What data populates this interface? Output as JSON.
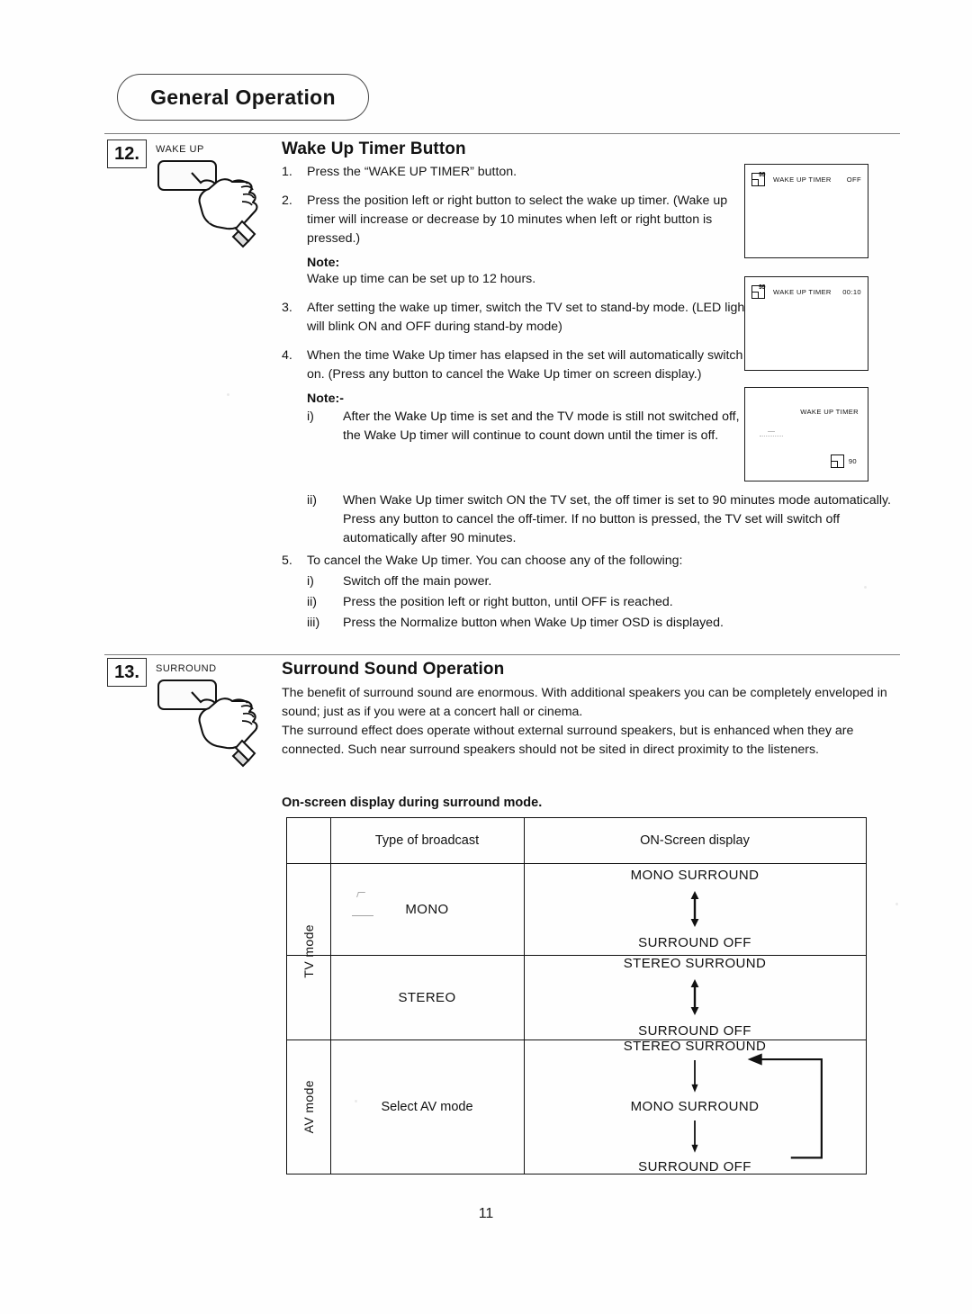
{
  "header": {
    "title": "General Operation"
  },
  "page_number": "11",
  "sections": [
    {
      "number": "12.",
      "button_label": "WAKE UP",
      "title": "Wake Up Timer Button",
      "steps": [
        {
          "mark": "1.",
          "text": "Press the “WAKE UP TIMER” button."
        },
        {
          "mark": "2.",
          "text": "Press the position left or right button to select the wake up timer. (Wake up timer will increase or decrease by 10 minutes when left or right button is pressed.)",
          "note_label": "Note:",
          "note_text": "Wake up time can be set up to 12 hours."
        },
        {
          "mark": "3.",
          "text": "After setting the wake up timer, switch the TV set to stand-by mode. (LED  light will blink ON and OFF during stand-by mode)"
        },
        {
          "mark": "4.",
          "text": "When the time Wake Up timer has elapsed in the set will automatically switch on. (Press any button to cancel the Wake Up timer on screen display.)",
          "note_label": "Note:-",
          "subitems": [
            {
              "mark": "i)",
              "text": "After the Wake Up time is set and the TV mode is still not switched off, the Wake Up timer will continue to count down until the timer is off."
            },
            {
              "mark": "ii)",
              "text": "When Wake Up timer switch ON the TV set, the off timer is set to 90 minutes mode automatically. Press any button to cancel the off-timer. If no button is pressed, the TV set will switch off automatically after 90 minutes."
            }
          ]
        },
        {
          "mark": "5.",
          "text": "To cancel the Wake Up timer. You can choose any of the following:",
          "subitems": [
            {
              "mark": "i)",
              "text": "Switch off the main power."
            },
            {
              "mark": "ii)",
              "text": "Press the position left or right button, until OFF is reached."
            },
            {
              "mark": "iii)",
              "text": "Press the Normalize button when Wake Up timer OSD is displayed."
            }
          ]
        }
      ]
    },
    {
      "number": "13.",
      "button_label": "SURROUND",
      "title": "Surround Sound Operation",
      "paragraphs": [
        "The benefit of surround sound are enormous. With additional speakers you can be completely enveloped in sound; just as if you were at a concert hall or cinema.",
        "The surround effect does operate without external surround speakers, but is enhanced when they are connected. Such near surround speakers should not be sited in direct proximity to the listeners."
      ],
      "table_caption": "On-screen display during surround mode."
    }
  ],
  "osd_screens": [
    {
      "icon_sup": "99",
      "label": "WAKE UP TIMER",
      "value": "OFF"
    },
    {
      "icon_sup": "99",
      "label": "WAKE UP TIMER",
      "value": "00:10"
    },
    {
      "label": "WAKE UP TIMER",
      "value": "90"
    }
  ],
  "surround_table": {
    "headers": {
      "mode": "",
      "broadcast": "Type of broadcast",
      "osd": "ON-Screen display"
    },
    "mode_groups": [
      {
        "label": "TV mode"
      },
      {
        "label": "AV mode"
      }
    ],
    "rows": [
      {
        "mode": "TV mode",
        "broadcast": "MONO",
        "osd_top": "MONO SURROUND",
        "osd_bottom": "SURROUND OFF",
        "arrow": "double"
      },
      {
        "mode": "TV mode",
        "broadcast": "STEREO",
        "osd_top": "STEREO SURROUND",
        "osd_bottom": "SURROUND OFF",
        "arrow": "double"
      },
      {
        "mode": "AV mode",
        "broadcast": "Select AV mode",
        "osd_top": "STEREO SURROUND",
        "osd_middle": "MONO SURROUND",
        "osd_bottom": "SURROUND OFF",
        "arrow": "cycle"
      }
    ]
  }
}
